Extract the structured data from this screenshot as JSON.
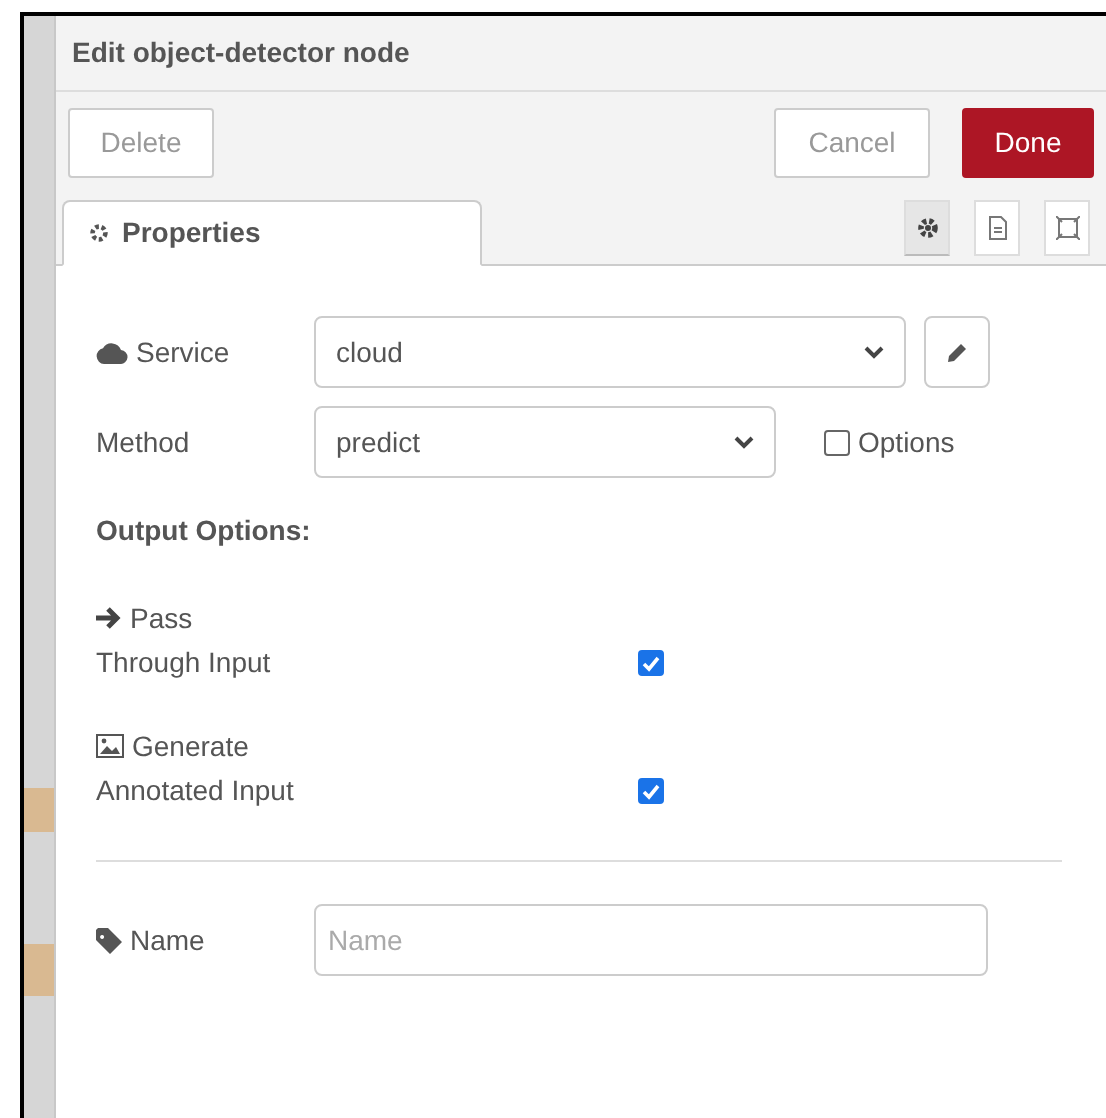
{
  "dialog": {
    "title": "Edit object-detector node",
    "buttons": [
      {
        "label": "Delete",
        "kind": "secondary"
      },
      {
        "label": "Cancel",
        "kind": "secondary"
      },
      {
        "label": "Done",
        "kind": "primary"
      }
    ],
    "tabs": [
      {
        "label": "Properties",
        "selected": true
      }
    ],
    "side_tabs": [
      {
        "kind": "settings",
        "selected": true
      },
      {
        "kind": "description",
        "selected": false
      },
      {
        "kind": "appearance",
        "selected": false
      }
    ],
    "service": {
      "label": "Service",
      "value": "cloud"
    },
    "method": {
      "label": "Method",
      "value": "predict",
      "options_label": "Options",
      "options_checked": false
    },
    "output_options": {
      "heading": "Output Options:",
      "items": [
        {
          "kind": "arrow",
          "label_lines": [
            "Pass",
            "Through Input"
          ],
          "checked": true
        },
        {
          "kind": "image",
          "label_lines": [
            "Generate",
            "Annotated Input"
          ],
          "checked": true
        }
      ]
    },
    "name": {
      "label": "Name",
      "placeholder": "Name"
    }
  }
}
